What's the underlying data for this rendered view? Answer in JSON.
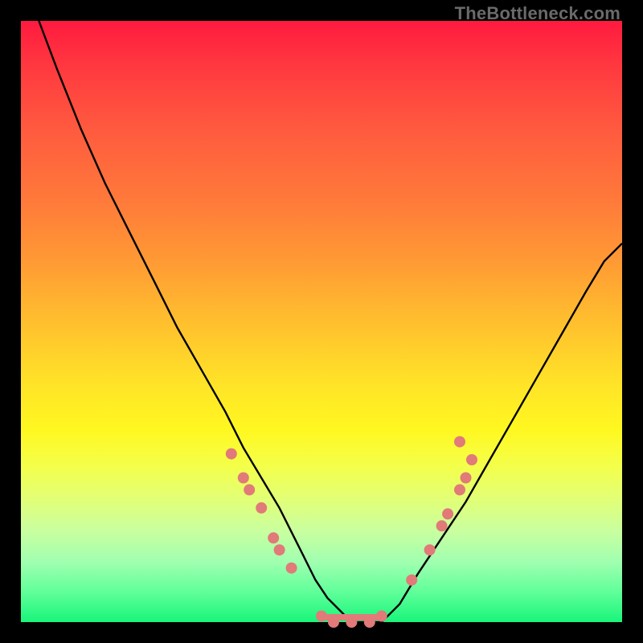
{
  "watermark": "TheBottleneck.com",
  "chart_data": {
    "type": "line",
    "title": "",
    "xlabel": "",
    "ylabel": "",
    "xlim": [
      0,
      100
    ],
    "ylim": [
      0,
      100
    ],
    "grid": false,
    "legend": false,
    "series": [
      {
        "name": "bottleneck-curve",
        "x": [
          3,
          6,
          10,
          14,
          18,
          22,
          26,
          30,
          34,
          37,
          40,
          43,
          45,
          47,
          49,
          51,
          53,
          55,
          57,
          60,
          63,
          66,
          70,
          74,
          78,
          82,
          86,
          90,
          94,
          97,
          100
        ],
        "y": [
          100,
          92,
          82,
          73,
          65,
          57,
          49,
          42,
          35,
          29,
          24,
          19,
          15,
          11,
          7,
          4,
          2,
          0,
          0,
          0,
          3,
          8,
          14,
          20,
          27,
          34,
          41,
          48,
          55,
          60,
          63
        ]
      }
    ],
    "flat_region_x": [
      50,
      60
    ],
    "scatter_clusters": [
      {
        "name": "left-cluster",
        "points": [
          {
            "x": 35,
            "y": 28
          },
          {
            "x": 37,
            "y": 24
          },
          {
            "x": 38,
            "y": 22
          },
          {
            "x": 40,
            "y": 19
          },
          {
            "x": 42,
            "y": 14
          },
          {
            "x": 43,
            "y": 12
          },
          {
            "x": 45,
            "y": 9
          }
        ]
      },
      {
        "name": "bottom-cluster",
        "points": [
          {
            "x": 50,
            "y": 1
          },
          {
            "x": 52,
            "y": 0
          },
          {
            "x": 55,
            "y": 0
          },
          {
            "x": 58,
            "y": 0
          },
          {
            "x": 60,
            "y": 1
          }
        ]
      },
      {
        "name": "right-cluster",
        "points": [
          {
            "x": 65,
            "y": 7
          },
          {
            "x": 68,
            "y": 12
          },
          {
            "x": 70,
            "y": 16
          },
          {
            "x": 71,
            "y": 18
          },
          {
            "x": 73,
            "y": 22
          },
          {
            "x": 74,
            "y": 24
          },
          {
            "x": 75,
            "y": 27
          },
          {
            "x": 73,
            "y": 30
          }
        ]
      }
    ],
    "colors": {
      "curve": "#000000",
      "dots": "#e17a78",
      "gradient_top": "#ff1a3f",
      "gradient_bottom": "#18f57a"
    }
  }
}
